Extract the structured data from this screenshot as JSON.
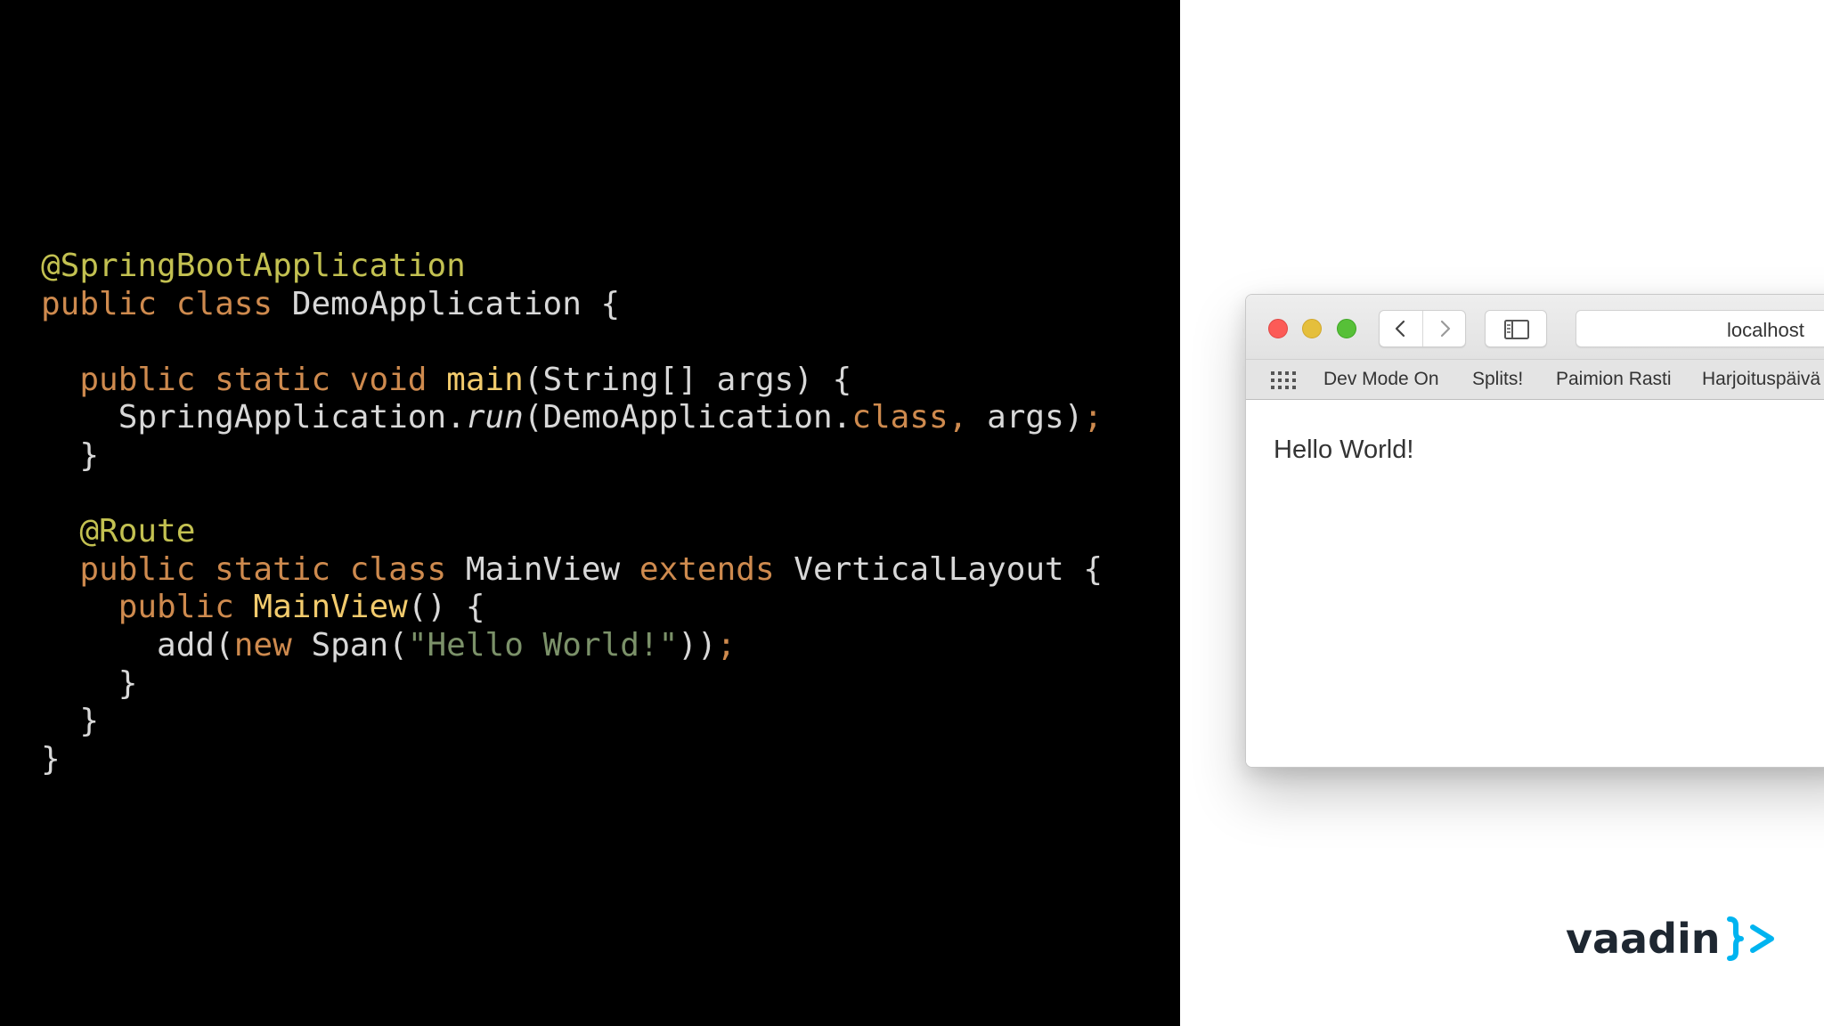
{
  "code": {
    "lines": [
      [
        {
          "t": "@SpringBootApplication",
          "c": "ann"
        }
      ],
      [
        {
          "t": "public class ",
          "c": "kw"
        },
        {
          "t": "DemoApplication {",
          "c": "txt"
        }
      ],
      [],
      [
        {
          "t": "  public static void ",
          "c": "kw"
        },
        {
          "t": "main",
          "c": "fn"
        },
        {
          "t": "(String[] args) {",
          "c": "txt"
        }
      ],
      [
        {
          "t": "    SpringApplication.",
          "c": "txt"
        },
        {
          "t": "run",
          "c": "txt",
          "i": true
        },
        {
          "t": "(DemoApplication.",
          "c": "txt"
        },
        {
          "t": "class",
          "c": "kw"
        },
        {
          "t": ", ",
          "c": "kw"
        },
        {
          "t": "args)",
          "c": "txt"
        },
        {
          "t": ";",
          "c": "kw"
        }
      ],
      [
        {
          "t": "  }",
          "c": "txt"
        }
      ],
      [],
      [
        {
          "t": "  @Route",
          "c": "ann"
        }
      ],
      [
        {
          "t": "  public static class ",
          "c": "kw"
        },
        {
          "t": "MainView ",
          "c": "txt"
        },
        {
          "t": "extends ",
          "c": "kw"
        },
        {
          "t": "VerticalLayout {",
          "c": "txt"
        }
      ],
      [
        {
          "t": "    public ",
          "c": "kw"
        },
        {
          "t": "MainView",
          "c": "fn"
        },
        {
          "t": "() {",
          "c": "txt"
        }
      ],
      [
        {
          "t": "      add(",
          "c": "txt"
        },
        {
          "t": "new ",
          "c": "kw"
        },
        {
          "t": "Span(",
          "c": "txt"
        },
        {
          "t": "\"Hello World!\"",
          "c": "str"
        },
        {
          "t": "))",
          "c": "txt"
        },
        {
          "t": ";",
          "c": "kw"
        }
      ],
      [
        {
          "t": "    }",
          "c": "txt"
        }
      ],
      [
        {
          "t": "  }",
          "c": "txt"
        }
      ],
      [
        {
          "t": "}",
          "c": "txt"
        }
      ]
    ]
  },
  "browser": {
    "url": "localhost",
    "bookmarks": [
      {
        "label": "Dev Mode On"
      },
      {
        "label": "Splits!"
      },
      {
        "label": "Paimion Rasti"
      },
      {
        "label": "Harjoituspäivä"
      }
    ],
    "icons": {
      "back": "chevron-left-icon",
      "forward": "chevron-right-icon",
      "sidebar": "sidebar-icon",
      "top_sites": "grid-icon"
    },
    "content": {
      "text": "Hello World!"
    }
  },
  "logo": {
    "text": "vaadin",
    "mark": "}>",
    "colors": {
      "word": "#1e2731",
      "mark": "#00b4f0"
    }
  },
  "colors": {
    "code_background": "#000000",
    "annotation": "#c3c151",
    "keyword": "#ce8a4e",
    "function": "#f2cb6d",
    "string": "#7b9169",
    "text": "#d8d8d8"
  }
}
